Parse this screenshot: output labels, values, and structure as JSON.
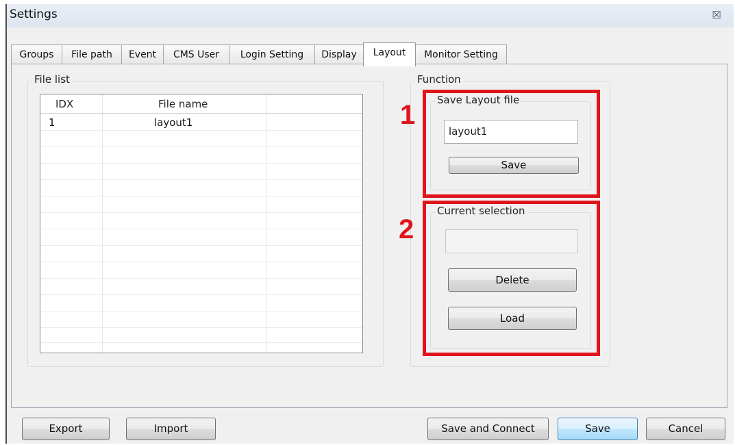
{
  "window": {
    "title": "Settings",
    "close_glyph": "☒"
  },
  "tabs": [
    {
      "label": "Groups"
    },
    {
      "label": "File path"
    },
    {
      "label": "Event"
    },
    {
      "label": "CMS User"
    },
    {
      "label": "Login Setting"
    },
    {
      "label": "Display"
    },
    {
      "label": "Layout"
    },
    {
      "label": "Monitor Setting"
    }
  ],
  "active_tab": "Layout",
  "file_list": {
    "group_label": "File list",
    "columns": [
      "IDX",
      "File name"
    ],
    "rows": [
      {
        "idx": "1",
        "name": "layout1"
      }
    ]
  },
  "function": {
    "group_label": "Function",
    "save_layout": {
      "group_label": "Save Layout file",
      "filename_value": "layout1",
      "save_label": "Save"
    },
    "current_selection": {
      "group_label": "Current selection",
      "value": "",
      "delete_label": "Delete",
      "load_label": "Load"
    }
  },
  "annotations": {
    "callout_1": "1",
    "callout_2": "2",
    "color": "#e0141b"
  },
  "footer": {
    "export_label": "Export",
    "import_label": "Import",
    "save_connect_label": "Save and Connect",
    "save_label": "Save",
    "cancel_label": "Cancel"
  }
}
